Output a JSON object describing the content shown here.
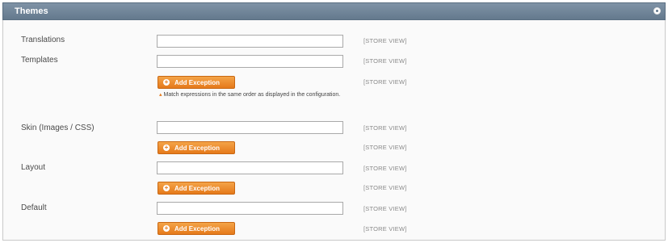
{
  "section": {
    "title": "Themes"
  },
  "rows": {
    "translations": {
      "label": "Translations",
      "value": "",
      "scope": "[STORE VIEW]"
    },
    "templates": {
      "label": "Templates",
      "value": "",
      "scope": "[STORE VIEW]",
      "exception_scope": "[STORE VIEW]"
    },
    "skin": {
      "label": "Skin (Images / CSS)",
      "value": "",
      "scope": "[STORE VIEW]",
      "exception_scope": "[STORE VIEW]"
    },
    "layout": {
      "label": "Layout",
      "value": "",
      "scope": "[STORE VIEW]",
      "exception_scope": "[STORE VIEW]"
    },
    "default": {
      "label": "Default",
      "value": "",
      "scope": "[STORE VIEW]",
      "exception_scope": "[STORE VIEW]"
    }
  },
  "add_exception_label": "Add Exception",
  "note": "Match expressions in the same order as displayed in the configuration.",
  "colors": {
    "header": "#64798d",
    "button": "#e5791a"
  }
}
